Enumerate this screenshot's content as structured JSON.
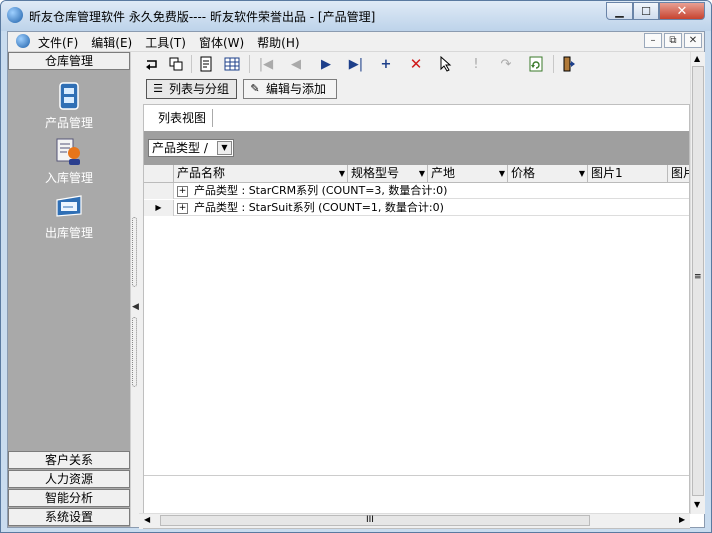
{
  "window": {
    "title": "昕友仓库管理软件 永久免费版---- 昕友软件荣誉出品  - [产品管理]",
    "buttons": {
      "minimize": "▁",
      "maximize": "☐",
      "close": "✕"
    }
  },
  "menu": [
    "文件(F)",
    "编辑(E)",
    "工具(T)",
    "窗体(W)",
    "帮助(H)"
  ],
  "mdi_buttons": [
    "–",
    "⧉",
    "✕"
  ],
  "left_panel": {
    "top_category": "仓库管理",
    "items": [
      {
        "label": "产品管理",
        "icon": "product-icon"
      },
      {
        "label": "入库管理",
        "icon": "stock-in-icon"
      },
      {
        "label": "出库管理",
        "icon": "stock-out-icon"
      }
    ],
    "bottom_categories": [
      "客户关系",
      "人力资源",
      "智能分析",
      "系统设置"
    ]
  },
  "toolbar_icons": [
    "return-icon",
    "copy-icon",
    "report-icon",
    "grid-icon",
    "first-icon",
    "prev-icon",
    "next-icon",
    "last-icon",
    "add-icon",
    "delete-icon",
    "pointer-icon",
    "pin-icon",
    "redo-icon",
    "refresh-icon",
    "exit-icon"
  ],
  "tabs": [
    {
      "label": "列表与分组",
      "active": true
    },
    {
      "label": "编辑与添加",
      "active": false
    }
  ],
  "view_tab": "列表视图",
  "group_chip": "产品类型 /",
  "columns": [
    "产品名称",
    "规格型号",
    "产地",
    "价格",
    "图片1",
    "图片"
  ],
  "rows": [
    {
      "text": "产品类型 : StarCRM系列 (COUNT=3, 数量合计:0)",
      "current": false
    },
    {
      "text": "产品类型 : StarSuit系列 (COUNT=1, 数量合计:0)",
      "current": true
    }
  ],
  "scroll_glyphs": {
    "up": "▲",
    "down": "▼",
    "left": "◀",
    "right": "▶",
    "grip": "III",
    "vgrip": "≡"
  },
  "colors": {
    "title_bar": "#c9dcef",
    "left_panel": "#a9a9a9",
    "group_panel": "#9f9f9f",
    "close_red": "#c7432f"
  }
}
